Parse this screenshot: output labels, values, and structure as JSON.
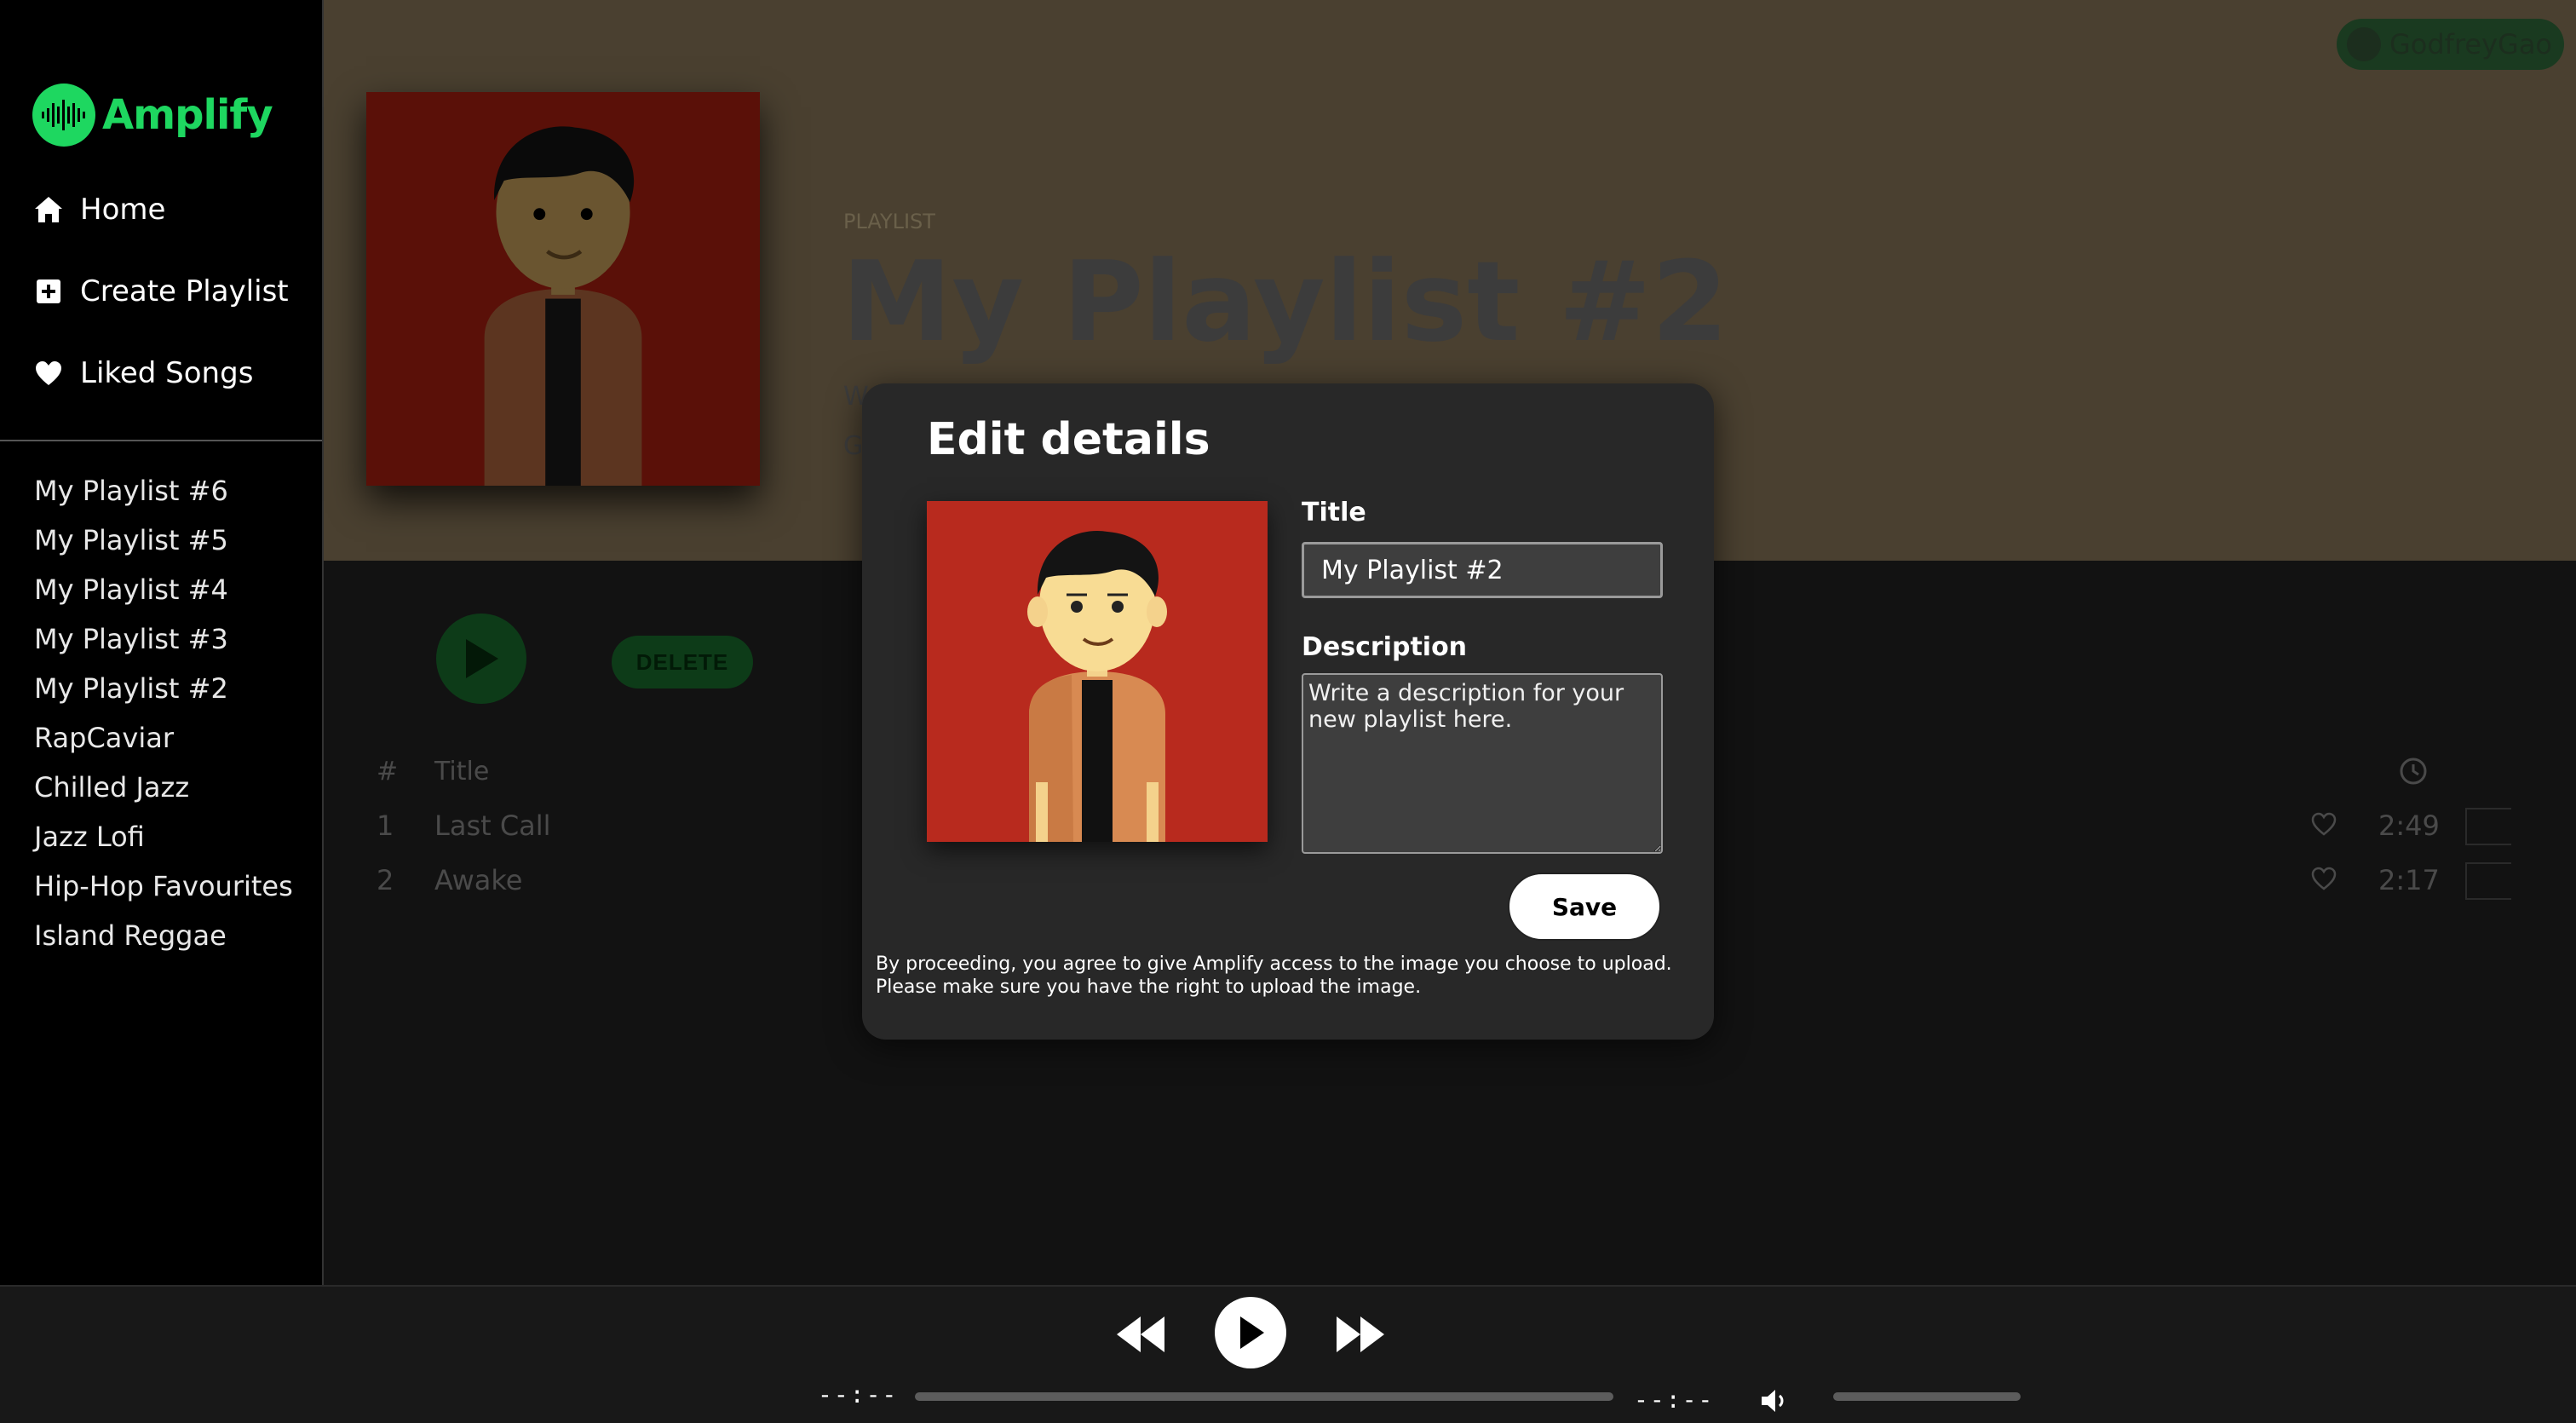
{
  "app": {
    "logo_text": "Amplify",
    "brand_color": "#1ed760"
  },
  "sidebar": {
    "nav": [
      {
        "label": "Home",
        "icon": "home-icon"
      },
      {
        "label": "Create Playlist",
        "icon": "plus-square-icon"
      },
      {
        "label": "Liked Songs",
        "icon": "heart-icon"
      }
    ],
    "playlists": [
      "My Playlist #6",
      "My Playlist #5",
      "My Playlist #4",
      "My Playlist #3",
      "My Playlist #2",
      "RapCaviar",
      "Chilled Jazz",
      "Jazz Lofi",
      "Hip-Hop Favourites",
      "Island Reggae"
    ]
  },
  "header": {
    "type_label": "PLAYLIST",
    "title": "My Playlist #2",
    "desc_fragment": "W",
    "owner_fragment": "G",
    "user": "GodfreyGao"
  },
  "actions": {
    "delete_label": "DELETE"
  },
  "tracks": {
    "columns": {
      "num": "#",
      "title": "Title",
      "duration_icon": "clock-icon"
    },
    "rows": [
      {
        "num": "1",
        "title": "Last Call",
        "duration": "2:49"
      },
      {
        "num": "2",
        "title": "Awake",
        "duration": "2:17"
      }
    ]
  },
  "modal": {
    "title": "Edit details",
    "title_label": "Title",
    "title_value": "My Playlist #2",
    "description_label": "Description",
    "description_placeholder": "Write a description for your new playlist here.",
    "save_label": "Save",
    "disclaimer": "By proceeding, you agree to give Amplify access to the image you choose to upload. Please make sure you have the right to upload the image."
  },
  "player": {
    "elapsed": "--:--",
    "remaining": "--:--",
    "progress": 0
  }
}
